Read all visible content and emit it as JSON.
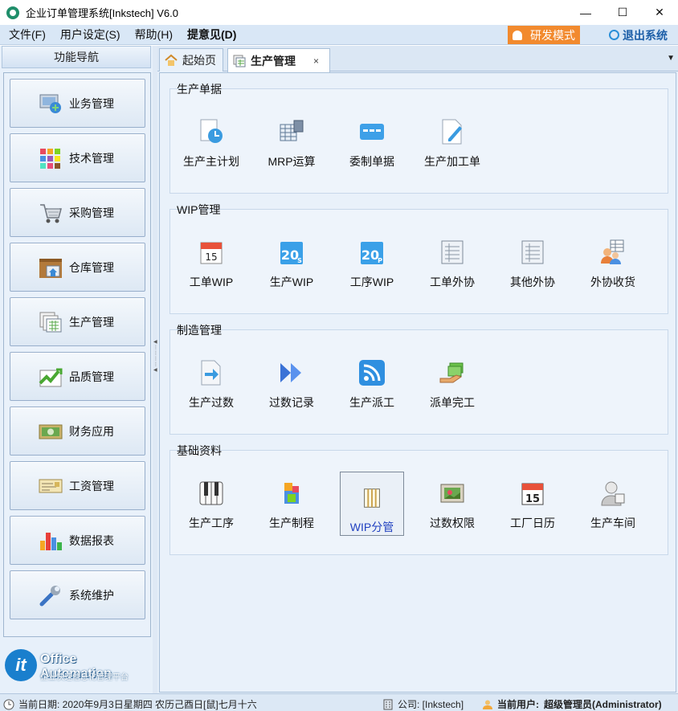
{
  "window": {
    "title": "企业订单管理系统[Inkstech] V6.0",
    "minimize": "—",
    "maximize": "☐",
    "close": "✕"
  },
  "menu": {
    "items": [
      "文件(F)",
      "用户设定(S)",
      "帮助(H)",
      "提意见(D)"
    ],
    "dev_mode": "研发模式",
    "exit": "退出系统"
  },
  "left": {
    "header": "功能导航",
    "nav": [
      {
        "label": "业务管理",
        "icon": "business-icon"
      },
      {
        "label": "技术管理",
        "icon": "tech-grid-icon"
      },
      {
        "label": "采购管理",
        "icon": "cart-icon"
      },
      {
        "label": "仓库管理",
        "icon": "warehouse-icon"
      },
      {
        "label": "生产管理",
        "icon": "production-icon"
      },
      {
        "label": "品质管理",
        "icon": "quality-chart-icon"
      },
      {
        "label": "财务应用",
        "icon": "money-icon"
      },
      {
        "label": "工资管理",
        "icon": "salary-icon"
      },
      {
        "label": "数据报表",
        "icon": "bar-chart-icon"
      },
      {
        "label": "系统维护",
        "icon": "wrench-icon"
      }
    ],
    "logo": {
      "mark": "it",
      "title": "Office Automation",
      "subtitle": "企业快速信息化管理平台"
    }
  },
  "tabs": [
    {
      "label": "起始页",
      "icon": "home-icon"
    },
    {
      "label": "生产管理",
      "icon": "production-icon",
      "close": "×"
    }
  ],
  "groups": [
    {
      "title": "生产单据",
      "items": [
        {
          "label": "生产主计划",
          "icon": "plan-clock-icon"
        },
        {
          "label": "MRP运算",
          "icon": "mrp-calc-icon"
        },
        {
          "label": "委制单据",
          "icon": "card-icon"
        },
        {
          "label": "生产加工单",
          "icon": "edit-doc-icon"
        }
      ]
    },
    {
      "title": "WIP管理",
      "items": [
        {
          "label": "工单WIP",
          "icon": "calendar-15-icon",
          "text": "15"
        },
        {
          "label": "生产WIP",
          "icon": "calendar-20s-icon",
          "text": "20"
        },
        {
          "label": "工序WIP",
          "icon": "calendar-20p-icon",
          "text": "20"
        },
        {
          "label": "工单外协",
          "icon": "list-doc-icon"
        },
        {
          "label": "其他外协",
          "icon": "list-doc-icon"
        },
        {
          "label": "外协收货",
          "icon": "users-receive-icon"
        }
      ]
    },
    {
      "title": "制造管理",
      "items": [
        {
          "label": "生产过数",
          "icon": "doc-arrow-icon"
        },
        {
          "label": "过数记录",
          "icon": "fast-forward-icon"
        },
        {
          "label": "生产派工",
          "icon": "rss-icon"
        },
        {
          "label": "派单完工",
          "icon": "hand-money-icon"
        }
      ]
    },
    {
      "title": "基础资料",
      "items": [
        {
          "label": "生产工序",
          "icon": "piano-icon"
        },
        {
          "label": "生产制程",
          "icon": "process-icon"
        },
        {
          "label": "WIP分管",
          "icon": "column-doc-icon",
          "selected": true
        },
        {
          "label": "过数权限",
          "icon": "photo-frame-icon"
        },
        {
          "label": "工厂日历",
          "icon": "calendar-15-icon",
          "text": "15"
        },
        {
          "label": "生产车间",
          "icon": "worker-icon"
        }
      ]
    }
  ],
  "status": {
    "date": "当前日期: 2020年9月3日星期四 农历己酉日[鼠]七月十六",
    "company": "公司: [Inkstech]",
    "user_label": "当前用户:",
    "user": "超级管理员(Administrator)"
  }
}
